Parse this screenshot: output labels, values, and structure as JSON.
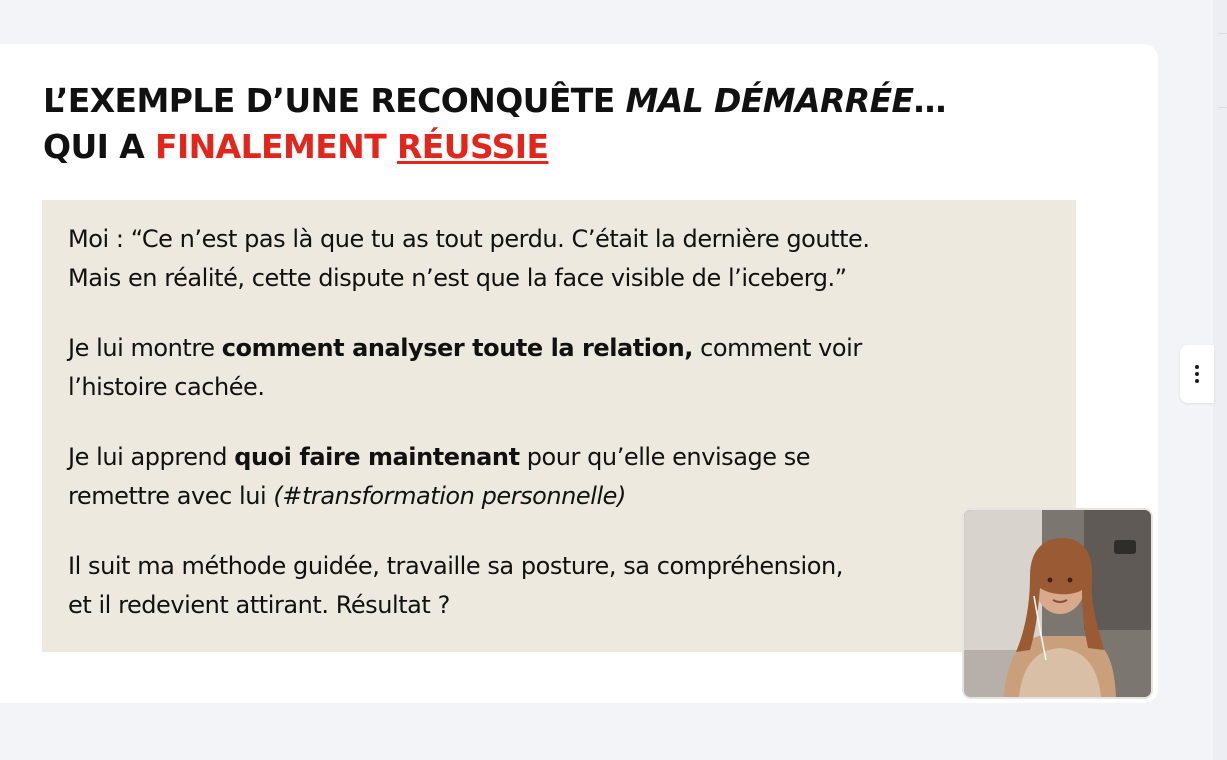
{
  "slide": {
    "title": {
      "line1_prefix": "L’EXEMPLE D’UNE RECONQUÊTE ",
      "line1_italic": "MAL DÉMARRÉE",
      "line1_suffix": "…",
      "line2_prefix": "QUI A ",
      "line2_red": "FINALEMENT",
      "line2_space": " ",
      "line2_red_underlined": "RÉUSSIE"
    },
    "paragraphs": {
      "p1": {
        "line1": "Moi : “Ce n’est pas là que tu as tout perdu. C’était la dernière goutte.",
        "line2": "Mais en réalité, cette dispute n’est que la face visible de l’iceberg.”"
      },
      "p2": {
        "before": "Je lui montre ",
        "bold": "comment analyser toute la relation,",
        "after": " comment voir",
        "line2": "l’histoire cachée."
      },
      "p3": {
        "before": "Je lui apprend ",
        "bold": "quoi faire maintenant",
        "after": " pour qu’elle envisage se",
        "line2_before": "remettre avec lui ",
        "line2_italic": "(#transformation personnelle)"
      },
      "p4": {
        "line1": "Il suit ma méthode guidée, travaille sa posture, sa compréhension,",
        "line2": "et il redevient attirant. Résultat ?"
      }
    },
    "colors": {
      "accent_red": "#e3261b",
      "box_background": "#ede9df",
      "text": "#111111"
    }
  },
  "presenter_video": {
    "icon": "presenter-webcam-thumbnail"
  },
  "side_menu": {
    "icon": "more-vertical-icon"
  }
}
